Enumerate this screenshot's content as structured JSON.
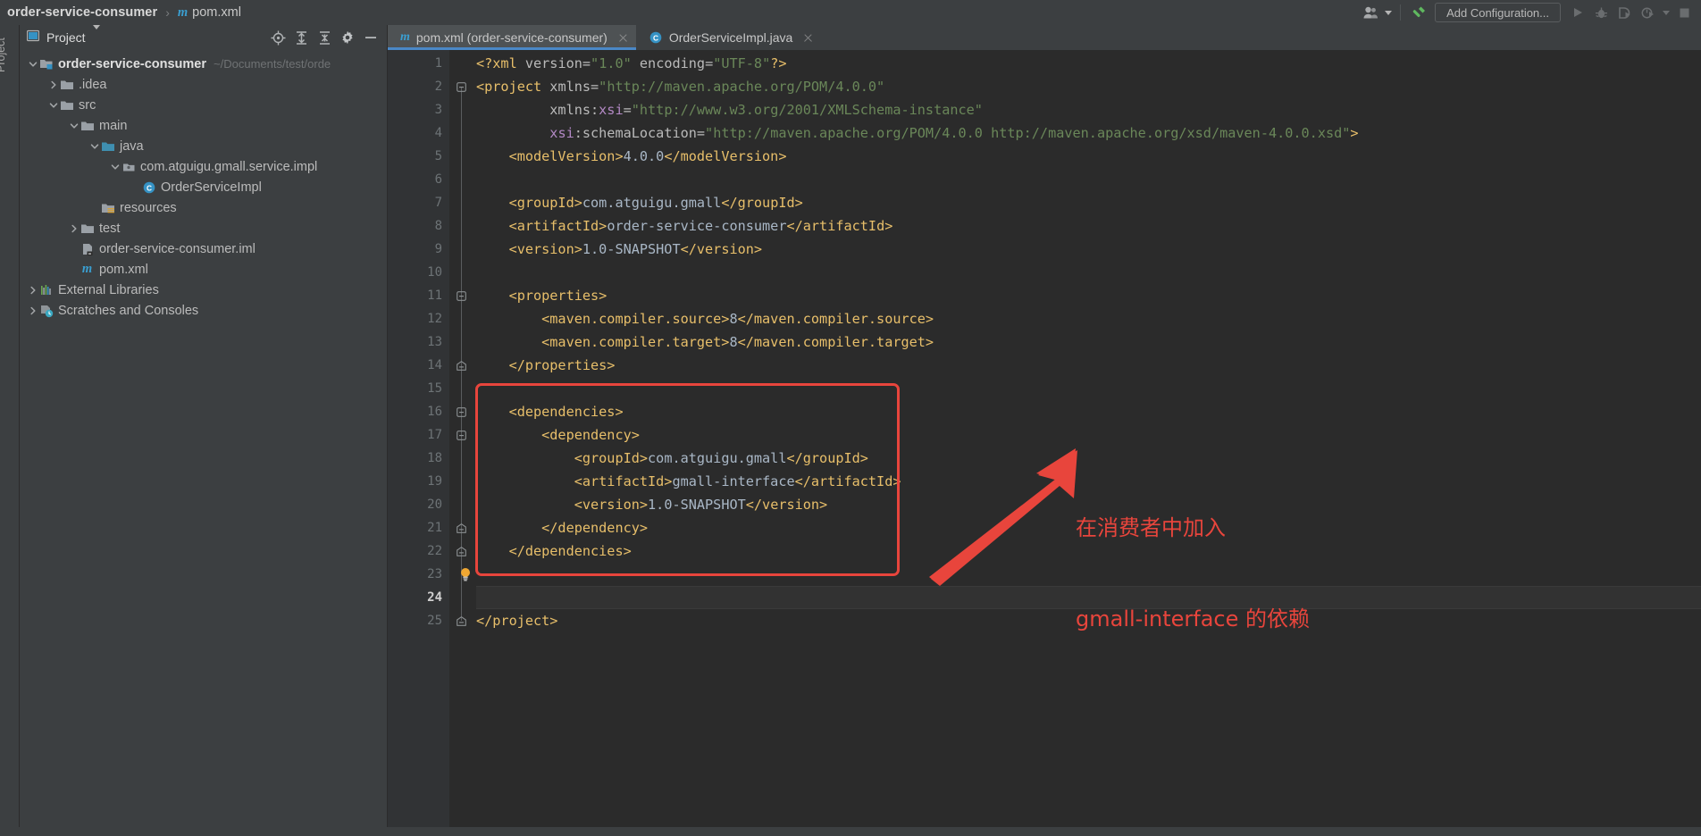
{
  "topbar": {
    "breadcrumb_project": "order-service-consumer",
    "breadcrumb_separator": "›",
    "breadcrumb_file_icon": "maven-m-icon",
    "breadcrumb_file": "pom.xml",
    "user_icon": "user-icon",
    "user_caret_icon": "chevron-down-icon",
    "build_icon": "hammer-icon",
    "add_configuration_label": "Add Configuration...",
    "run_icon": "run-icon",
    "debug_icon": "debug-bug-icon",
    "coverage_icon": "run-with-coverage-icon",
    "profile_icon": "profiler-icon",
    "more_caret_icon": "chevron-down-icon",
    "stop_icon": "stop-square-icon"
  },
  "left_strip": {
    "label": "Project"
  },
  "project_panel": {
    "icon": "project-view-icon",
    "title": "Project",
    "dropdown_icon": "chevron-down-icon",
    "tools": [
      {
        "name": "locate-target-icon",
        "glyph": "target"
      },
      {
        "name": "expand-all-icon",
        "glyph": "expand"
      },
      {
        "name": "collapse-all-icon",
        "glyph": "collapse"
      },
      {
        "name": "settings-gear-icon",
        "glyph": "gear"
      },
      {
        "name": "hide-panel-icon",
        "glyph": "minus"
      }
    ],
    "tree": [
      {
        "label": "order-service-consumer",
        "path": "~/Documents/test/orde",
        "icon": "module-icon",
        "arrow": "expanded",
        "indent": 0,
        "bold": true
      },
      {
        "label": ".idea",
        "path": "",
        "icon": "folder-icon",
        "arrow": "collapsed",
        "indent": 1,
        "bold": false
      },
      {
        "label": "src",
        "path": "",
        "icon": "folder-icon",
        "arrow": "expanded",
        "indent": 1,
        "bold": false
      },
      {
        "label": "main",
        "path": "",
        "icon": "folder-icon",
        "arrow": "expanded",
        "indent": 2,
        "bold": false
      },
      {
        "label": "java",
        "path": "",
        "icon": "source-folder-icon",
        "arrow": "expanded",
        "indent": 3,
        "bold": false
      },
      {
        "label": "com.atguigu.gmall.service.impl",
        "path": "",
        "icon": "package-icon",
        "arrow": "expanded",
        "indent": 4,
        "bold": false
      },
      {
        "label": "OrderServiceImpl",
        "path": "",
        "icon": "java-class-icon",
        "arrow": "none",
        "indent": 5,
        "bold": false
      },
      {
        "label": "resources",
        "path": "",
        "icon": "resources-folder-icon",
        "arrow": "none",
        "indent": 3,
        "bold": false
      },
      {
        "label": "test",
        "path": "",
        "icon": "folder-icon",
        "arrow": "collapsed",
        "indent": 2,
        "bold": false
      },
      {
        "label": "order-service-consumer.iml",
        "path": "",
        "icon": "iml-file-icon",
        "arrow": "none",
        "indent": 2,
        "bold": false
      },
      {
        "label": "pom.xml",
        "path": "",
        "icon": "maven-m-icon",
        "arrow": "none",
        "indent": 2,
        "bold": false
      },
      {
        "label": "External Libraries",
        "path": "",
        "icon": "libraries-icon",
        "arrow": "collapsed",
        "indent": 0,
        "bold": false
      },
      {
        "label": "Scratches and Consoles",
        "path": "",
        "icon": "scratches-icon",
        "arrow": "collapsed",
        "indent": 0,
        "bold": false
      }
    ]
  },
  "editor": {
    "tabs": [
      {
        "label": "pom.xml (order-service-consumer)",
        "icon": "maven-m-icon",
        "active": true,
        "close_icon": "close-icon"
      },
      {
        "label": "OrderServiceImpl.java",
        "icon": "java-class-icon",
        "active": false,
        "close_icon": "close-icon"
      }
    ],
    "current_line": 24,
    "total_lines": 25,
    "lines": [
      {
        "n": 1,
        "indent": 0,
        "fold": "none",
        "tokens": [
          {
            "t": "pi",
            "v": "<?xml "
          },
          {
            "t": "at",
            "v": "version"
          },
          {
            "t": "eq",
            "v": "="
          },
          {
            "t": "st",
            "v": "\"1.0\""
          },
          {
            "t": "at",
            "v": " encoding"
          },
          {
            "t": "eq",
            "v": "="
          },
          {
            "t": "st",
            "v": "\"UTF-8\""
          },
          {
            "t": "pi",
            "v": "?>"
          }
        ]
      },
      {
        "n": 2,
        "indent": 0,
        "fold": "open",
        "tokens": [
          {
            "t": "tg",
            "v": "<project "
          },
          {
            "t": "at",
            "v": "xmlns"
          },
          {
            "t": "eq",
            "v": "="
          },
          {
            "t": "st",
            "v": "\"http://maven.apache.org/POM/4.0.0\""
          }
        ]
      },
      {
        "n": 3,
        "indent": 0,
        "fold": "none",
        "tokens": [
          {
            "t": "at",
            "v": "         xmlns:"
          },
          {
            "t": "ns",
            "v": "xsi"
          },
          {
            "t": "eq",
            "v": "="
          },
          {
            "t": "st",
            "v": "\"http://www.w3.org/2001/XMLSchema-instance\""
          }
        ]
      },
      {
        "n": 4,
        "indent": 0,
        "fold": "none",
        "tokens": [
          {
            "t": "at",
            "v": "         "
          },
          {
            "t": "ns",
            "v": "xsi"
          },
          {
            "t": "at",
            "v": ":schemaLocation"
          },
          {
            "t": "eq",
            "v": "="
          },
          {
            "t": "st",
            "v": "\"http://maven.apache.org/POM/4.0.0 http://maven.apache.org/xsd/maven-4.0.0.xsd\""
          },
          {
            "t": "tg",
            "v": ">"
          }
        ]
      },
      {
        "n": 5,
        "indent": 0,
        "fold": "none",
        "tokens": [
          {
            "t": "tg",
            "v": "    <modelVersion>"
          },
          {
            "t": "tx",
            "v": "4.0.0"
          },
          {
            "t": "tg",
            "v": "</modelVersion>"
          }
        ]
      },
      {
        "n": 6,
        "indent": 0,
        "fold": "none",
        "tokens": []
      },
      {
        "n": 7,
        "indent": 0,
        "fold": "none",
        "tokens": [
          {
            "t": "tg",
            "v": "    <groupId>"
          },
          {
            "t": "tx",
            "v": "com.atguigu.gmall"
          },
          {
            "t": "tg",
            "v": "</groupId>"
          }
        ]
      },
      {
        "n": 8,
        "indent": 0,
        "fold": "none",
        "tokens": [
          {
            "t": "tg",
            "v": "    <artifactId>"
          },
          {
            "t": "tx",
            "v": "order-service-consumer"
          },
          {
            "t": "tg",
            "v": "</artifactId>"
          }
        ]
      },
      {
        "n": 9,
        "indent": 0,
        "fold": "none",
        "tokens": [
          {
            "t": "tg",
            "v": "    <version>"
          },
          {
            "t": "tx",
            "v": "1.0-SNAPSHOT"
          },
          {
            "t": "tg",
            "v": "</version>"
          }
        ]
      },
      {
        "n": 10,
        "indent": 0,
        "fold": "none",
        "tokens": []
      },
      {
        "n": 11,
        "indent": 0,
        "fold": "open",
        "tokens": [
          {
            "t": "tg",
            "v": "    <properties>"
          }
        ]
      },
      {
        "n": 12,
        "indent": 0,
        "fold": "none",
        "tokens": [
          {
            "t": "tg",
            "v": "        <maven.compiler.source>"
          },
          {
            "t": "tx",
            "v": "8"
          },
          {
            "t": "tg",
            "v": "</maven.compiler.source>"
          }
        ]
      },
      {
        "n": 13,
        "indent": 0,
        "fold": "none",
        "tokens": [
          {
            "t": "tg",
            "v": "        <maven.compiler.target>"
          },
          {
            "t": "tx",
            "v": "8"
          },
          {
            "t": "tg",
            "v": "</maven.compiler.target>"
          }
        ]
      },
      {
        "n": 14,
        "indent": 0,
        "fold": "close",
        "tokens": [
          {
            "t": "tg",
            "v": "    </properties>"
          }
        ]
      },
      {
        "n": 15,
        "indent": 0,
        "fold": "none",
        "tokens": []
      },
      {
        "n": 16,
        "indent": 0,
        "fold": "open",
        "tokens": [
          {
            "t": "tg",
            "v": "    <dependencies>"
          }
        ]
      },
      {
        "n": 17,
        "indent": 0,
        "fold": "open",
        "tokens": [
          {
            "t": "tg",
            "v": "        <dependency>"
          }
        ]
      },
      {
        "n": 18,
        "indent": 0,
        "fold": "none",
        "tokens": [
          {
            "t": "tg",
            "v": "            <groupId>"
          },
          {
            "t": "tx",
            "v": "com.atguigu.gmall"
          },
          {
            "t": "tg",
            "v": "</groupId>"
          }
        ]
      },
      {
        "n": 19,
        "indent": 0,
        "fold": "none",
        "tokens": [
          {
            "t": "tg",
            "v": "            <artifactId>"
          },
          {
            "t": "tx",
            "v": "gmall-interface"
          },
          {
            "t": "tg",
            "v": "</artifactId>"
          }
        ]
      },
      {
        "n": 20,
        "indent": 0,
        "fold": "none",
        "tokens": [
          {
            "t": "tg",
            "v": "            <version>"
          },
          {
            "t": "tx",
            "v": "1.0-SNAPSHOT"
          },
          {
            "t": "tg",
            "v": "</version>"
          }
        ]
      },
      {
        "n": 21,
        "indent": 0,
        "fold": "close",
        "tokens": [
          {
            "t": "tg",
            "v": "        </dependency>"
          }
        ]
      },
      {
        "n": 22,
        "indent": 0,
        "fold": "close",
        "tokens": [
          {
            "t": "tg",
            "v": "    </dependencies>"
          }
        ]
      },
      {
        "n": 23,
        "indent": 0,
        "fold": "none",
        "tokens": [],
        "bulb": true
      },
      {
        "n": 24,
        "indent": 0,
        "fold": "none",
        "tokens": []
      },
      {
        "n": 25,
        "indent": 0,
        "fold": "close",
        "tokens": [
          {
            "t": "tg",
            "v": "</project>"
          }
        ]
      }
    ]
  },
  "annotation": {
    "box_color": "#e8453c",
    "arrow_color": "#e8453c",
    "text_color": "#e8453c",
    "text_line1": "在消费者中加入",
    "text_line2": "gmall-interface 的依赖",
    "box_label": "dependencies-highlight-box",
    "arrow_label": "callout-arrow"
  }
}
